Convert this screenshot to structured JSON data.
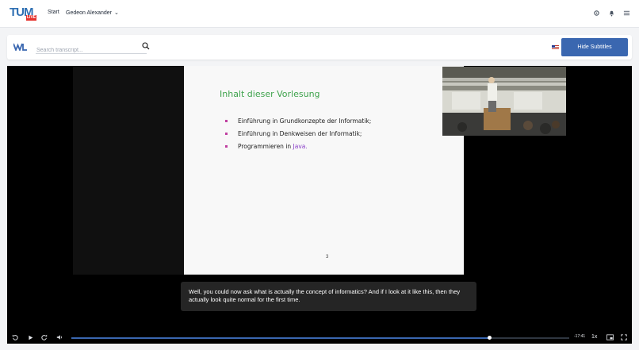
{
  "header": {
    "logo_text": "TUM",
    "logo_badge": "LIVE",
    "nav_start": "Start",
    "user_name": "Gedeon Alexander",
    "icons": [
      "gear-icon",
      "bell-icon",
      "menu-icon"
    ]
  },
  "toolbar": {
    "search_placeholder": "Search transcript...",
    "language_flag": "us-flag-icon",
    "hide_subtitles_label": "Hide Subtitles"
  },
  "slide": {
    "title": "Inhalt dieser Vorlesung",
    "items": [
      "Einführung in Grundkonzepte der Informatik;",
      "Einführung in Denkweisen der Informatik;",
      "Programmieren in "
    ],
    "java_word": "Java",
    "java_suffix": ".",
    "page_number": "3"
  },
  "subtitle": {
    "text": "Well, you could now ask what is actually the concept of informatics? And if I look at it like this, then they actually look quite normal for the first time."
  },
  "player": {
    "remaining_time": "-17:41",
    "speed": "1x",
    "progress_fraction": 0.84
  },
  "colors": {
    "accent": "#3a67b0",
    "slide_title": "#3fa34d",
    "live_badge": "#e5312b"
  }
}
